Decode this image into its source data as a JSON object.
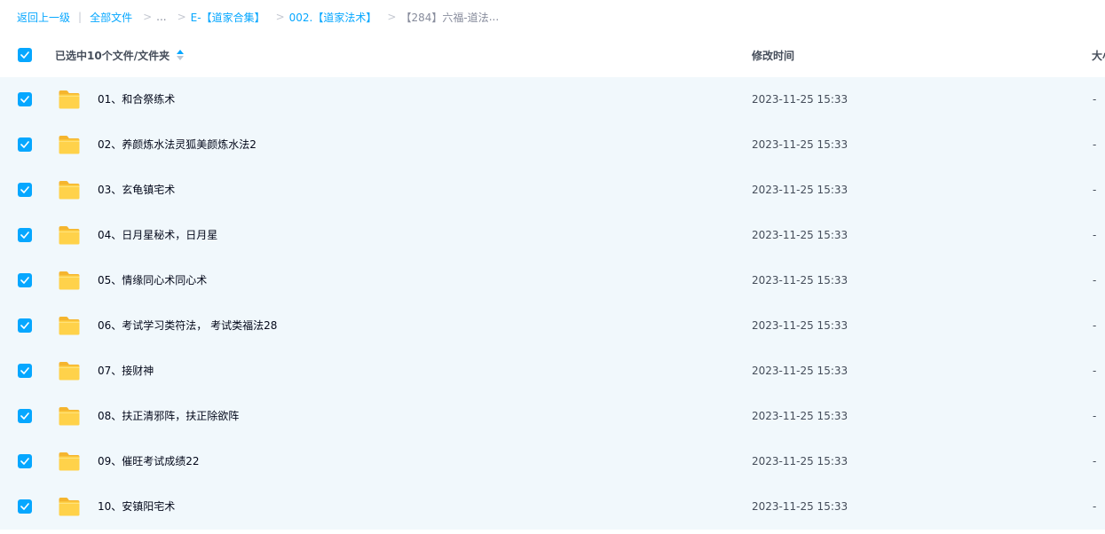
{
  "breadcrumb": {
    "back": "返回上一级",
    "sep": "|",
    "items": [
      "全部文件",
      "...",
      "E-【道家合集】",
      "002.【道家法术】"
    ],
    "current": "【284】六福-道法",
    "ellipsis": "..."
  },
  "header": {
    "select_label": "已选中10个文件/文件夹",
    "col_time": "修改时间",
    "col_size": "大小",
    "sort_icon": "sort-icon"
  },
  "colors": {
    "accent": "#06a7ff",
    "row_selected_bg": "#f1f8fc",
    "folder": "#ffcc33"
  },
  "rows": [
    {
      "name": "01、和合祭练术",
      "time": "2023-11-25 15:33",
      "size": "-",
      "icon": "folder-icon",
      "checked": true
    },
    {
      "name": "02、养颜炼水法灵狐美颜炼水法2",
      "time": "2023-11-25 15:33",
      "size": "-",
      "icon": "folder-icon",
      "checked": true
    },
    {
      "name": "03、玄龟镇宅术",
      "time": "2023-11-25 15:33",
      "size": "-",
      "icon": "folder-icon",
      "checked": true
    },
    {
      "name": "04、日月星秘术，日月星",
      "time": "2023-11-25 15:33",
      "size": "-",
      "icon": "folder-icon",
      "checked": true
    },
    {
      "name": "05、情缘同心术同心术",
      "time": "2023-11-25 15:33",
      "size": "-",
      "icon": "folder-icon",
      "checked": true
    },
    {
      "name": "06、考试学习类符法， 考试类福法28",
      "time": "2023-11-25 15:33",
      "size": "-",
      "icon": "folder-icon",
      "checked": true
    },
    {
      "name": "07、接财神",
      "time": "2023-11-25 15:33",
      "size": "-",
      "icon": "folder-icon",
      "checked": true
    },
    {
      "name": "08、扶正清邪阵，扶正除欲阵",
      "time": "2023-11-25 15:33",
      "size": "-",
      "icon": "folder-icon",
      "checked": true
    },
    {
      "name": "09、催旺考试成绩22",
      "time": "2023-11-25 15:33",
      "size": "-",
      "icon": "folder-icon",
      "checked": true
    },
    {
      "name": "10、安镇阳宅术",
      "time": "2023-11-25 15:33",
      "size": "-",
      "icon": "folder-icon",
      "checked": true
    }
  ]
}
